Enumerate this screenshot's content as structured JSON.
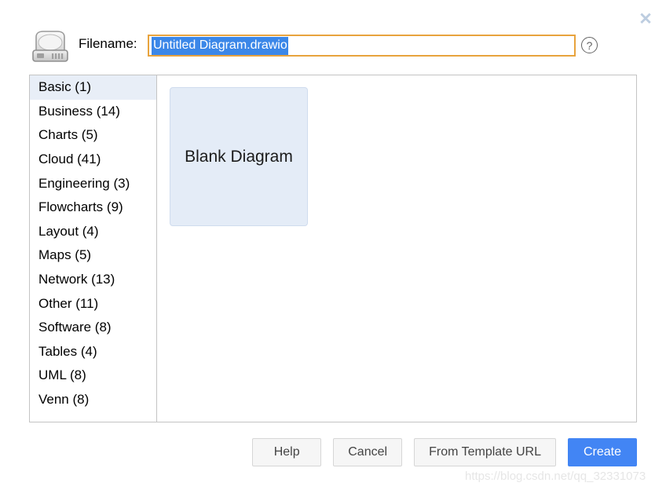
{
  "dialog": {
    "close_label": "✕",
    "filename_label": "Filename:",
    "filename_value": "Untitled Diagram.drawio",
    "filename_placeholder": "Untitled Diagram.drawio",
    "help_icon_label": "?",
    "disk_icon_name": "hard-disk-icon"
  },
  "categories": [
    {
      "label": "Basic (1)",
      "name": "Basic",
      "count": 1,
      "selected": true
    },
    {
      "label": "Business (14)",
      "name": "Business",
      "count": 14,
      "selected": false
    },
    {
      "label": "Charts (5)",
      "name": "Charts",
      "count": 5,
      "selected": false
    },
    {
      "label": "Cloud (41)",
      "name": "Cloud",
      "count": 41,
      "selected": false
    },
    {
      "label": "Engineering (3)",
      "name": "Engineering",
      "count": 3,
      "selected": false
    },
    {
      "label": "Flowcharts (9)",
      "name": "Flowcharts",
      "count": 9,
      "selected": false
    },
    {
      "label": "Layout (4)",
      "name": "Layout",
      "count": 4,
      "selected": false
    },
    {
      "label": "Maps (5)",
      "name": "Maps",
      "count": 5,
      "selected": false
    },
    {
      "label": "Network (13)",
      "name": "Network",
      "count": 13,
      "selected": false
    },
    {
      "label": "Other (11)",
      "name": "Other",
      "count": 11,
      "selected": false
    },
    {
      "label": "Software (8)",
      "name": "Software",
      "count": 8,
      "selected": false
    },
    {
      "label": "Tables (4)",
      "name": "Tables",
      "count": 4,
      "selected": false
    },
    {
      "label": "UML (8)",
      "name": "UML",
      "count": 8,
      "selected": false
    },
    {
      "label": "Venn (8)",
      "name": "Venn",
      "count": 8,
      "selected": false
    }
  ],
  "templates": [
    {
      "label": "Blank Diagram",
      "selected": true
    }
  ],
  "footer": {
    "help_label": "Help",
    "cancel_label": "Cancel",
    "from_template_url_label": "From Template URL",
    "create_label": "Create"
  },
  "watermark": "https://blog.csdn.net/qq_32331073",
  "colors": {
    "accent_blue": "#4285f4",
    "selection_blue": "#3b87e8",
    "focus_border": "#e8a33d",
    "card_fill": "#e4ecf7",
    "sidebar_selected": "#e8eef7"
  }
}
